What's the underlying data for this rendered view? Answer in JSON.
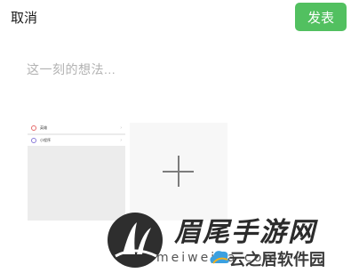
{
  "header": {
    "cancel_label": "取消",
    "publish_label": "发表"
  },
  "composer": {
    "placeholder": "这一刻的想法..."
  },
  "thumbnail": {
    "rows": [
      {
        "label": "英雄",
        "icon": "heart-icon"
      },
      {
        "label": "小程序",
        "icon": "miniprogram-icon"
      }
    ]
  },
  "add_tile": {
    "icon": "plus-icon"
  },
  "watermark": {
    "title": "眉尾手游网",
    "domain": "meiweida.com",
    "sub": "云之居软件园"
  },
  "colors": {
    "accent": "#52c060",
    "placeholder": "#b2b2b2"
  }
}
